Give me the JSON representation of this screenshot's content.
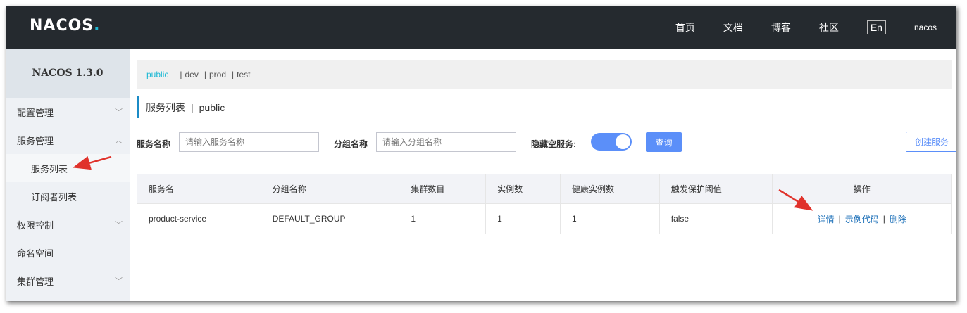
{
  "header": {
    "logo": "NACOS",
    "logo_dot": ".",
    "nav": [
      "首页",
      "文档",
      "博客",
      "社区"
    ],
    "lang": "En",
    "user": "nacos"
  },
  "sidebar": {
    "version": "NACOS 1.3.0",
    "items": [
      {
        "label": "配置管理",
        "chevron": "﹀"
      },
      {
        "label": "服务管理",
        "chevron": "︿"
      },
      {
        "label": "服务列表"
      },
      {
        "label": "订阅者列表"
      },
      {
        "label": "权限控制",
        "chevron": "﹀"
      },
      {
        "label": "命名空间"
      },
      {
        "label": "集群管理",
        "chevron": "﹀"
      }
    ]
  },
  "namespaces": {
    "active": "public",
    "others": [
      "dev",
      "prod",
      "test"
    ],
    "separator": "|"
  },
  "page": {
    "title": "服务列表",
    "separator": "|",
    "namespace": "public"
  },
  "filters": {
    "service_name_label": "服务名称",
    "service_name_placeholder": "请输入服务名称",
    "group_name_label": "分组名称",
    "group_name_placeholder": "请输入分组名称",
    "hide_empty_label": "隐藏空服务:",
    "hide_empty_on": true,
    "search_button": "查询",
    "create_button": "创建服务"
  },
  "table": {
    "columns": [
      "服务名",
      "分组名称",
      "集群数目",
      "实例数",
      "健康实例数",
      "触发保护阈值",
      "操作"
    ],
    "rows": [
      {
        "service": "product-service",
        "group": "DEFAULT_GROUP",
        "clusters": "1",
        "instances": "1",
        "healthy": "1",
        "threshold": "false",
        "actions": [
          "详情",
          "示例代码",
          "删除"
        ]
      }
    ],
    "action_separator": "|"
  },
  "colors": {
    "topbar": "#252a2f",
    "accent": "#1fb9d4",
    "primary": "#5b8ff9",
    "link": "#1b6fb8",
    "annotation_arrow": "#e0322b"
  }
}
